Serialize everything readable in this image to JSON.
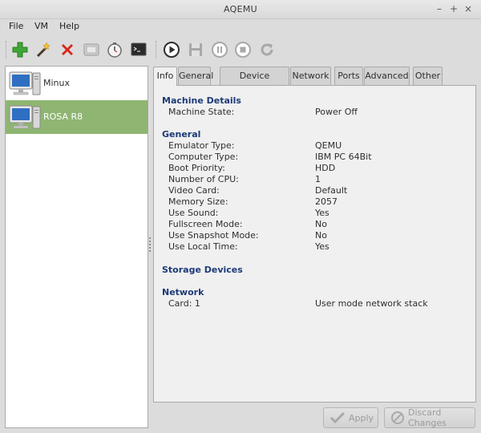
{
  "window": {
    "title": "AQEMU",
    "controls": [
      "–",
      "+",
      "×"
    ]
  },
  "menubar": {
    "items": [
      "File",
      "VM",
      "Help"
    ]
  },
  "toolbar": {
    "buttons": [
      "add-vm",
      "wizard",
      "delete-vm",
      "vm-screenshot",
      "vm-settings",
      "monitor-console",
      "start",
      "save",
      "pause",
      "stop",
      "reset"
    ]
  },
  "vm_list": {
    "items": [
      {
        "name": "Minux",
        "selected": false
      },
      {
        "name": "ROSA R8",
        "selected": true
      }
    ]
  },
  "tabs": [
    "Info",
    "General",
    "Device Manager",
    "Network",
    "Ports",
    "Advanced",
    "Other"
  ],
  "active_tab": "Info",
  "info": {
    "machine_details": {
      "title": "Machine Details",
      "rows": [
        {
          "label": "Machine State:",
          "value": "Power Off"
        }
      ]
    },
    "general": {
      "title": "General",
      "rows": [
        {
          "label": "Emulator Type:",
          "value": "QEMU"
        },
        {
          "label": "Computer Type:",
          "value": "IBM PC 64Bit"
        },
        {
          "label": "Boot Priority:",
          "value": "HDD"
        },
        {
          "label": "Number of CPU:",
          "value": "1"
        },
        {
          "label": "Video Card:",
          "value": "Default"
        },
        {
          "label": "Memory Size:",
          "value": "2057"
        },
        {
          "label": "Use Sound:",
          "value": "Yes"
        },
        {
          "label": "Fullscreen Mode:",
          "value": "No"
        },
        {
          "label": "Use Snapshot Mode:",
          "value": "No"
        },
        {
          "label": "Use Local Time:",
          "value": "Yes"
        }
      ]
    },
    "storage_devices": {
      "title": "Storage Devices"
    },
    "network": {
      "title": "Network",
      "rows": [
        {
          "label": "Card: 1",
          "value": "User mode network stack"
        }
      ]
    }
  },
  "buttons": {
    "apply": "Apply",
    "discard": "Discard Changes"
  }
}
